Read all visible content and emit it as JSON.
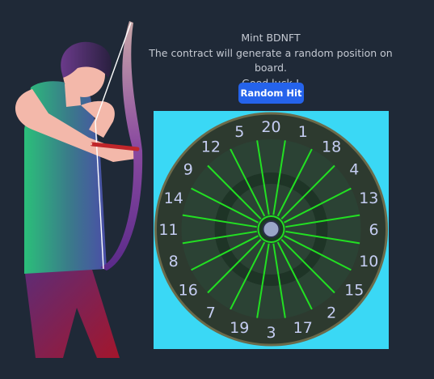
{
  "header": {
    "title": "Mint BDNFT",
    "subtitle": "The contract will generate a random position on board.",
    "luck": "Good luck !"
  },
  "button": {
    "label": "Random Hit"
  },
  "board": {
    "numbers": [
      "20",
      "1",
      "18",
      "4",
      "13",
      "6",
      "10",
      "15",
      "2",
      "17",
      "3",
      "19",
      "7",
      "16",
      "8",
      "11",
      "14",
      "9",
      "12",
      "5"
    ],
    "colors": {
      "panel": "#3ad8f5",
      "outer_ring": "#2d3a2f",
      "rim": "#6b6a4a",
      "inner_ring": "#2b4234",
      "ring_band": "#1e3426",
      "spokes": "#22e022",
      "bull": "#9aa6c8",
      "numbers": "#c5cdf2"
    }
  },
  "colors": {
    "background": "#1f2937",
    "header_text": "#c4c9d2",
    "button": "#2563eb"
  }
}
